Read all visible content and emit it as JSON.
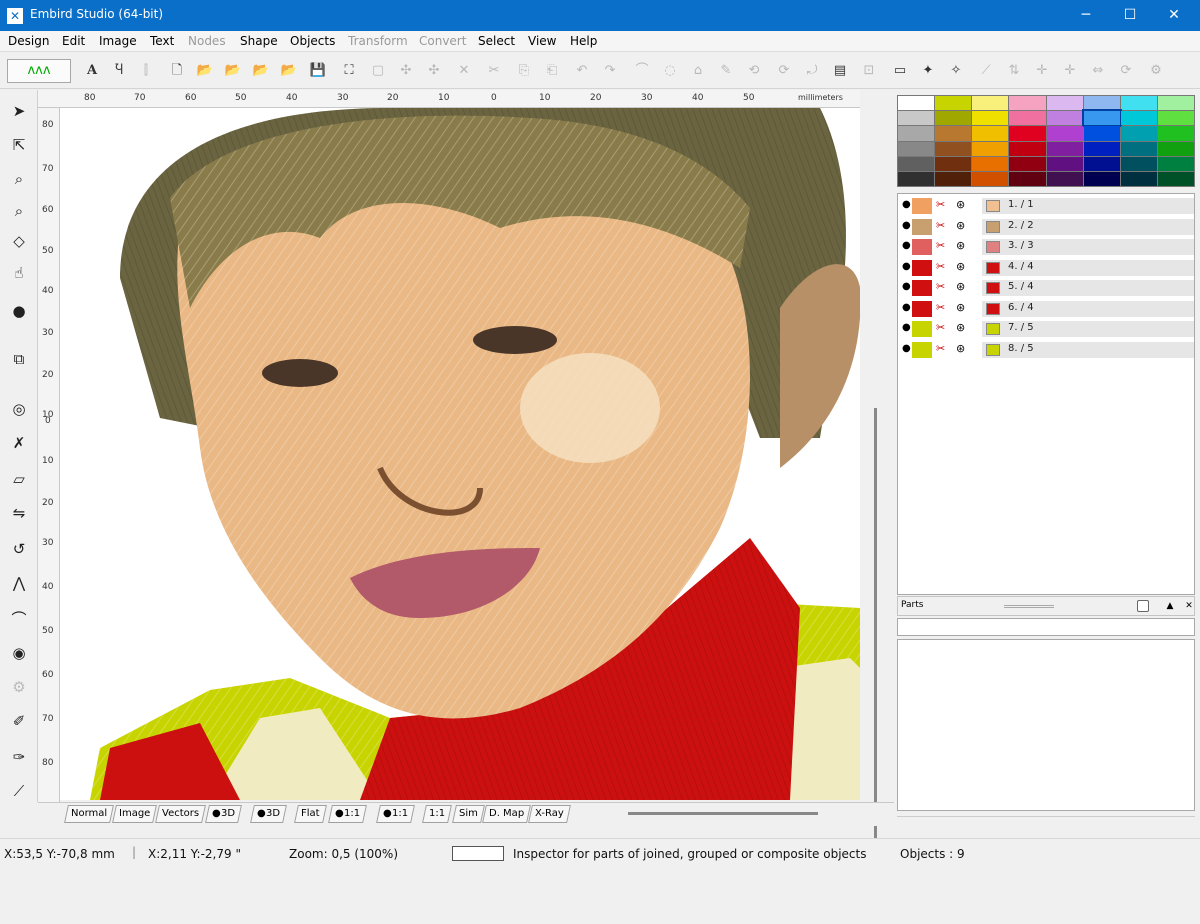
{
  "window": {
    "title": "Embird Studio (64-bit)",
    "minimize": "─",
    "maximize": "☐",
    "close": "✕"
  },
  "menu": [
    "Design",
    "Edit",
    "Image",
    "Text",
    "Nodes",
    "Shape",
    "Objects",
    "Transform",
    "Convert",
    "Select",
    "View",
    "Help"
  ],
  "menu_disabled": [
    "Nodes",
    "Transform",
    "Convert"
  ],
  "ruler": {
    "unit": "millimeters",
    "h_ticks": [
      "80",
      "70",
      "60",
      "50",
      "40",
      "30",
      "20",
      "10",
      "0",
      "10",
      "20",
      "30",
      "40",
      "50"
    ],
    "v_ticks": [
      "80",
      "70",
      "60",
      "50",
      "40",
      "30",
      "20",
      "10",
      "0",
      "10",
      "20",
      "30",
      "40",
      "50",
      "60",
      "70",
      "80"
    ]
  },
  "view_tabs": [
    "Normal",
    "Image",
    "Vectors",
    "3D",
    "3D",
    "Flat",
    "1:1",
    "1:1",
    "1:1",
    "Sim",
    "D. Map",
    "X-Ray"
  ],
  "status": {
    "mm_coords": "X:53,5  Y:-70,8 mm",
    "inch_coords": "X:2,11  Y:-2,79 \"",
    "zoom": "Zoom:  0,5 (100%)",
    "inspector": "Inspector for parts of joined, grouped or composite objects",
    "objects": "Objects : 9"
  },
  "palette": [
    "#ffffff",
    "#c8d400",
    "#f8f07a",
    "#f5a3c0",
    "#dcb8f0",
    "#90b8f0",
    "#40e0f0",
    "#a0f0a0",
    "#c8c8c8",
    "#a0a800",
    "#f0e000",
    "#f070a0",
    "#c080e0",
    "#3898f0",
    "#00c8d8",
    "#60e040",
    "#a8a8a8",
    "#b87830",
    "#f0c000",
    "#e00020",
    "#b040d0",
    "#0050e0",
    "#00a0b0",
    "#20c020",
    "#888888",
    "#905020",
    "#f0a000",
    "#c00010",
    "#8020a0",
    "#0020c0",
    "#007080",
    "#10a010",
    "#606060",
    "#703010",
    "#e87000",
    "#900010",
    "#601080",
    "#001090",
    "#005060",
    "#008040",
    "#303030",
    "#502008",
    "#d05000",
    "#600010",
    "#401050",
    "#000050",
    "#003040",
    "#005028"
  ],
  "objects": [
    {
      "label": "1.  / 1",
      "color": "#f0c090",
      "thumb": "#f0a060"
    },
    {
      "label": "2.  / 2",
      "color": "#c8a070",
      "thumb": "#c8a070"
    },
    {
      "label": "3.  / 3",
      "color": "#e08080",
      "thumb": "#e06060"
    },
    {
      "label": "4.  / 4",
      "color": "#d01010",
      "thumb": "#d01010"
    },
    {
      "label": "5.  / 4",
      "color": "#d01010",
      "thumb": "#d01010"
    },
    {
      "label": "6.  / 4",
      "color": "#d01010",
      "thumb": "#d01010"
    },
    {
      "label": "7.  / 5",
      "color": "#c8d400",
      "thumb": "#c8d400"
    },
    {
      "label": "8.  / 5",
      "color": "#c8d400",
      "thumb": "#c8d400"
    }
  ],
  "parts": {
    "title": "Parts",
    "btn_top": "▲",
    "btn_close": "✕"
  }
}
